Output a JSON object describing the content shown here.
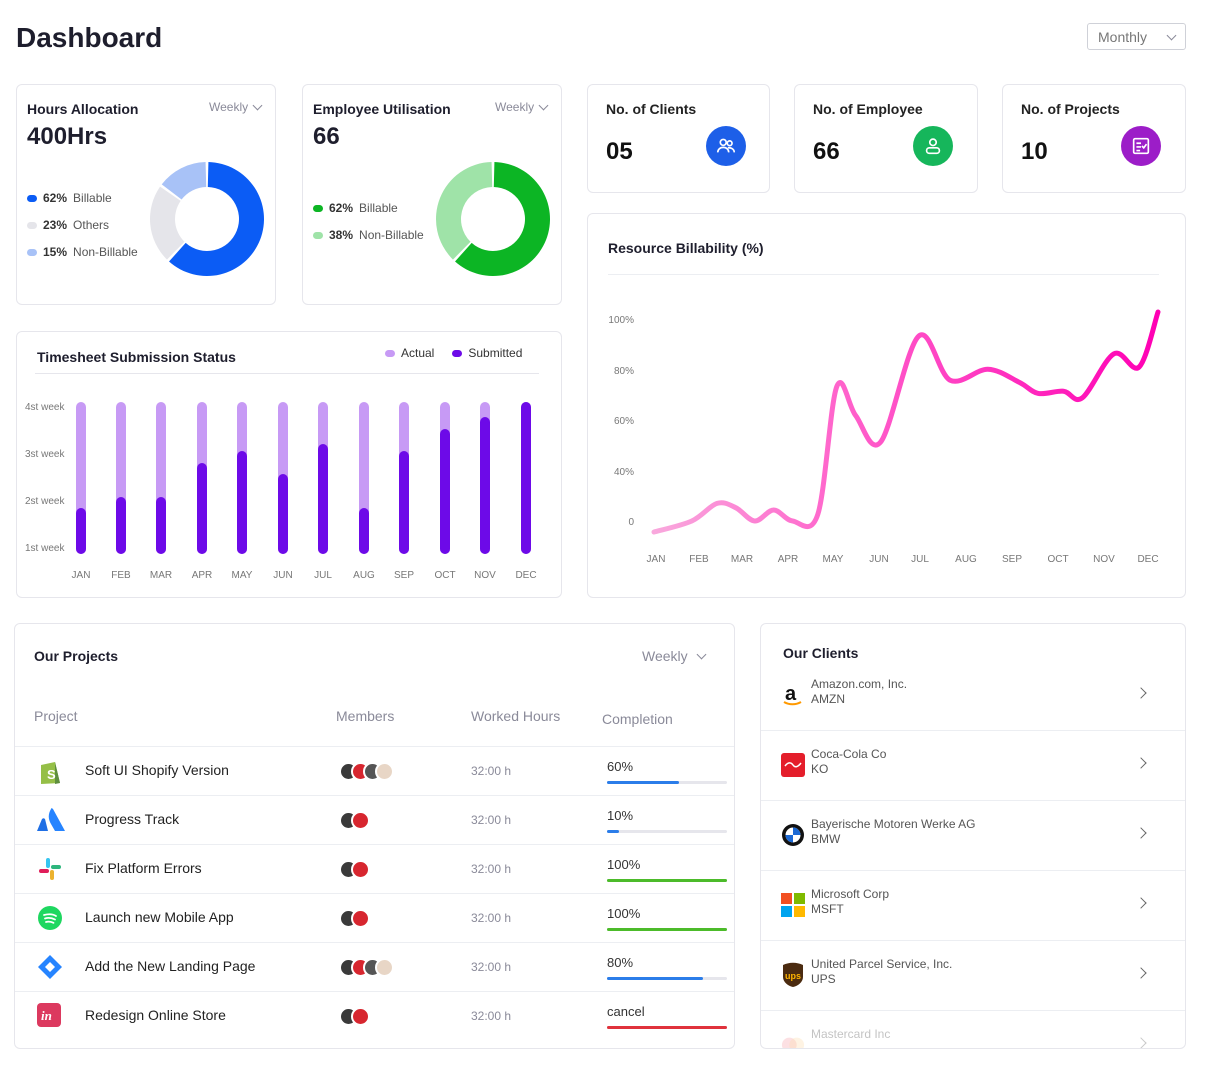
{
  "page": {
    "title": "Dashboard",
    "period": "Monthly"
  },
  "hours": {
    "title": "Hours Allocation",
    "period": "Weekly",
    "value": "400Hrs",
    "legend": [
      {
        "pct": "62%",
        "label": "Billable",
        "color": "#0b5cf5"
      },
      {
        "pct": "23%",
        "label": "Others",
        "color": "#e5e5ea"
      },
      {
        "pct": "15%",
        "label": "Non-Billable",
        "color": "#a8c2f7"
      }
    ]
  },
  "util": {
    "title": "Employee Utilisation",
    "period": "Weekly",
    "value": "66",
    "legend": [
      {
        "pct": "62%",
        "label": "Billable",
        "color": "#0cb524"
      },
      {
        "pct": "38%",
        "label": "Non-Billable",
        "color": "#9fe3a8"
      }
    ]
  },
  "stats": [
    {
      "label": "No. of Clients",
      "value": "05",
      "icon": "clients-icon",
      "color": "#1d5fe8"
    },
    {
      "label": "No. of Employee",
      "value": "66",
      "icon": "employee-icon",
      "color": "#16b65b"
    },
    {
      "label": "No. of Projects",
      "value": "10",
      "icon": "projects-icon",
      "color": "#9c1dc8"
    }
  ],
  "timesheet": {
    "title": "Timesheet Submission Status",
    "legend_actual": "Actual",
    "legend_submitted": "Submitted",
    "y_labels": [
      "4st week",
      "3st week",
      "2st week",
      "1st week"
    ],
    "months": [
      "JAN",
      "FEB",
      "MAR",
      "APR",
      "MAY",
      "JUN",
      "JUL",
      "AUG",
      "SEP",
      "OCT",
      "NOV",
      "DEC"
    ],
    "actual_color": "#c79af5",
    "submitted_color": "#6d0ae8"
  },
  "billability": {
    "title": "Resource Billability (%)",
    "y_ticks": [
      "100%",
      "80%",
      "60%",
      "40%",
      "0"
    ],
    "months": [
      "JAN",
      "FEB",
      "MAR",
      "APR",
      "MAY",
      "JUN",
      "JUL",
      "AUG",
      "SEP",
      "OCT",
      "NOV",
      "DEC"
    ]
  },
  "chart_data": [
    {
      "type": "bar",
      "title": "Timesheet Submission Status",
      "categories": [
        "JAN",
        "FEB",
        "MAR",
        "APR",
        "MAY",
        "JUN",
        "JUL",
        "AUG",
        "SEP",
        "OCT",
        "NOV",
        "DEC"
      ],
      "y_tick_labels": [
        "1st week",
        "2st week",
        "3st week",
        "4st week"
      ],
      "series": [
        {
          "name": "Actual",
          "values": [
            4,
            4,
            4,
            4,
            4,
            4,
            4,
            4,
            4,
            4,
            4,
            4
          ]
        },
        {
          "name": "Submitted",
          "values": [
            1.2,
            1.5,
            1.5,
            2.4,
            2.7,
            2.1,
            2.9,
            1.2,
            2.7,
            3.3,
            3.6,
            4.0
          ]
        }
      ],
      "ylim": [
        0,
        4
      ]
    },
    {
      "type": "line",
      "title": "Resource Billability (%)",
      "x": [
        "JAN",
        "FEB",
        "MAR",
        "APR",
        "MAY",
        "JUN",
        "JUL",
        "AUG",
        "SEP",
        "OCT",
        "NOV",
        "DEC"
      ],
      "y_tick_labels": [
        "0",
        "40%",
        "60%",
        "80%",
        "100%"
      ],
      "points": [
        [
          0,
          0
        ],
        [
          0.6,
          5
        ],
        [
          1.0,
          13
        ],
        [
          1.3,
          11
        ],
        [
          1.6,
          5
        ],
        [
          1.9,
          10
        ],
        [
          2.2,
          5
        ],
        [
          2.6,
          8
        ],
        [
          2.9,
          66
        ],
        [
          3.2,
          53
        ],
        [
          3.6,
          41
        ],
        [
          4.2,
          89
        ],
        [
          4.7,
          69
        ],
        [
          5.3,
          74
        ],
        [
          5.8,
          68
        ],
        [
          6.1,
          63
        ],
        [
          6.5,
          64
        ],
        [
          6.8,
          61
        ],
        [
          7.3,
          81
        ],
        [
          7.7,
          75
        ],
        [
          8.0,
          100
        ]
      ],
      "ylim": [
        0,
        100
      ],
      "color_start": "#f9a8dd",
      "color_end": "#ff00b4"
    }
  ],
  "projects": {
    "title": "Our Projects",
    "period": "Weekly",
    "columns": [
      "Project",
      "Members",
      "Worked Hours",
      "Completion"
    ],
    "rows": [
      {
        "name": "Soft UI Shopify Version",
        "icon": "shopify-icon",
        "hours": "32:00 h",
        "completion": "60%",
        "progress": 0.6,
        "color": "#2b7de9",
        "members": 4
      },
      {
        "name": "Progress Track",
        "icon": "atlassian-icon",
        "hours": "32:00 h",
        "completion": "10%",
        "progress": 0.1,
        "color": "#2b7de9",
        "members": 2
      },
      {
        "name": "Fix Platform Errors",
        "icon": "slack-icon",
        "hours": "32:00 h",
        "completion": "100%",
        "progress": 1.0,
        "color": "#4cbb2a",
        "members": 2
      },
      {
        "name": "Launch new Mobile App",
        "icon": "spotify-icon",
        "hours": "32:00 h",
        "completion": "100%",
        "progress": 1.0,
        "color": "#4cbb2a",
        "members": 2
      },
      {
        "name": "Add the New Landing Page",
        "icon": "jira-icon",
        "hours": "32:00 h",
        "completion": "80%",
        "progress": 0.8,
        "color": "#2b7de9",
        "members": 4
      },
      {
        "name": "Redesign Online Store",
        "icon": "invision-icon",
        "hours": "32:00 h",
        "completion": "cancel",
        "progress": 1.0,
        "color": "#e0323c",
        "members": 2
      }
    ]
  },
  "clients": {
    "title": "Our Clients",
    "rows": [
      {
        "name": "Amazon.com, Inc.",
        "ticker": "AMZN",
        "icon": "amazon-icon"
      },
      {
        "name": "Coca-Cola Co",
        "ticker": "KO",
        "icon": "cocacola-icon"
      },
      {
        "name": "Bayerische Motoren Werke AG",
        "ticker": "BMW",
        "icon": "bmw-icon"
      },
      {
        "name": "Microsoft Corp",
        "ticker": "MSFT",
        "icon": "microsoft-icon"
      },
      {
        "name": "United Parcel Service, Inc.",
        "ticker": "UPS",
        "icon": "ups-icon"
      },
      {
        "name": "Mastercard Inc",
        "ticker": "",
        "icon": "mastercard-icon"
      }
    ]
  }
}
